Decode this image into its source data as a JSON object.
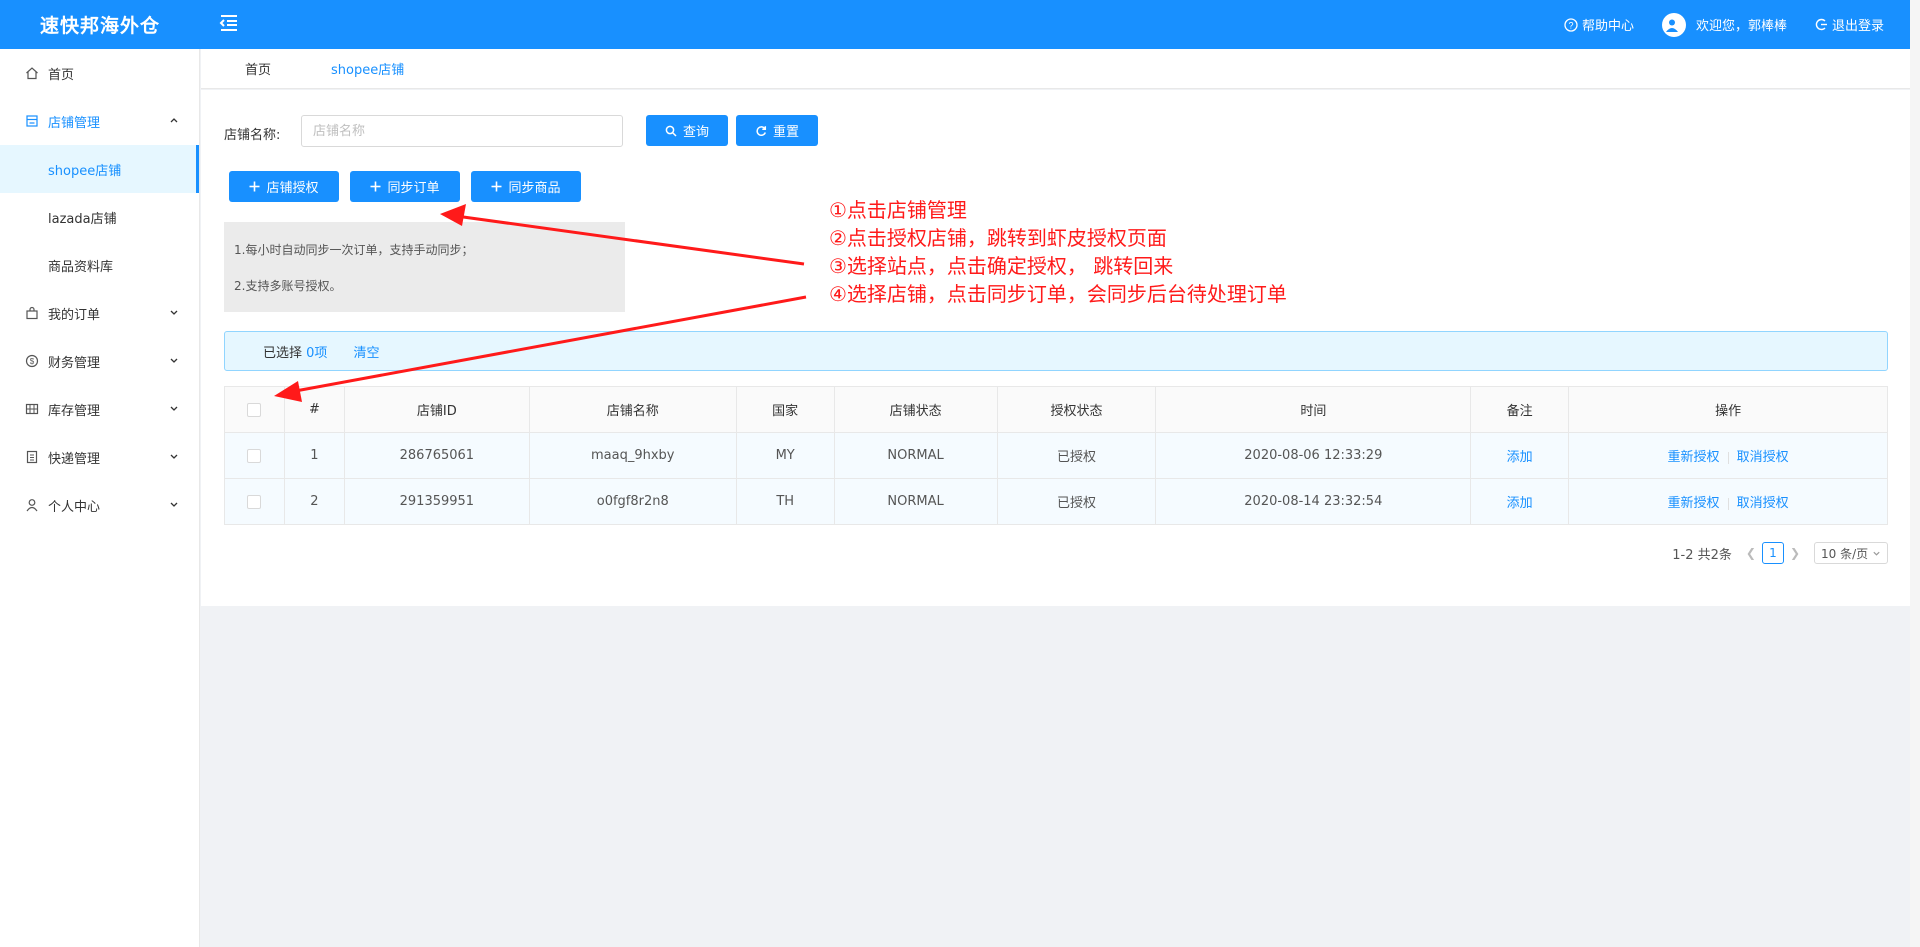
{
  "header": {
    "logo": "速快邦海外仓",
    "help": "帮助中心",
    "welcome": "欢迎您，郭棒棒",
    "logout": "退出登录"
  },
  "sidebar": {
    "items": [
      {
        "label": "首页",
        "icon": "home-icon"
      },
      {
        "label": "店铺管理",
        "icon": "shop-icon",
        "open": true,
        "children": [
          "shopee店铺",
          "lazada店铺",
          "商品资料库"
        ]
      },
      {
        "label": "我的订单",
        "icon": "bag-icon"
      },
      {
        "label": "财务管理",
        "icon": "dollar-icon"
      },
      {
        "label": "库存管理",
        "icon": "grid-icon"
      },
      {
        "label": "快递管理",
        "icon": "list-icon"
      },
      {
        "label": "个人中心",
        "icon": "user-icon"
      }
    ]
  },
  "tabs": [
    "首页",
    "shopee店铺"
  ],
  "search": {
    "label": "店铺名称:",
    "placeholder": "店铺名称",
    "query_btn": "查询",
    "reset_btn": "重置"
  },
  "actions": {
    "authorize": "店铺授权",
    "sync_orders": "同步订单",
    "sync_products": "同步商品"
  },
  "notice": {
    "line1": "1.每小时自动同步一次订单，支持手动同步；",
    "line2": "2.支持多账号授权。"
  },
  "selection": {
    "prefix": "已选择",
    "count": "0项",
    "clear": "清空"
  },
  "table": {
    "headers": [
      "#",
      "店铺ID",
      "店铺名称",
      "国家",
      "店铺状态",
      "授权状态",
      "时间",
      "备注",
      "操作"
    ],
    "rows": [
      {
        "no": "1",
        "id": "286765061",
        "name": "maaq_9hxby",
        "country": "MY",
        "status": "NORMAL",
        "auth": "已授权",
        "time": "2020-08-06 12:33:29",
        "remark": "添加",
        "op1": "重新授权",
        "op2": "取消授权"
      },
      {
        "no": "2",
        "id": "291359951",
        "name": "o0fgf8r2n8",
        "country": "TH",
        "status": "NORMAL",
        "auth": "已授权",
        "time": "2020-08-14 23:32:54",
        "remark": "添加",
        "op1": "重新授权",
        "op2": "取消授权"
      }
    ]
  },
  "pager": {
    "total": "1-2 共2条",
    "page": "1",
    "size": "10 条/页"
  },
  "annotation": {
    "lines": [
      "①点击店铺管理",
      "②点击授权店铺，跳转到虾皮授权页面",
      "③选择站点，点击确定授权， 跳转回来",
      "④选择店铺，点击同步订单，会同步后台待处理订单"
    ],
    "color": "#ff1a1a"
  },
  "colors": {
    "primary": "#1890ff",
    "header_bg": "#1890ff"
  }
}
